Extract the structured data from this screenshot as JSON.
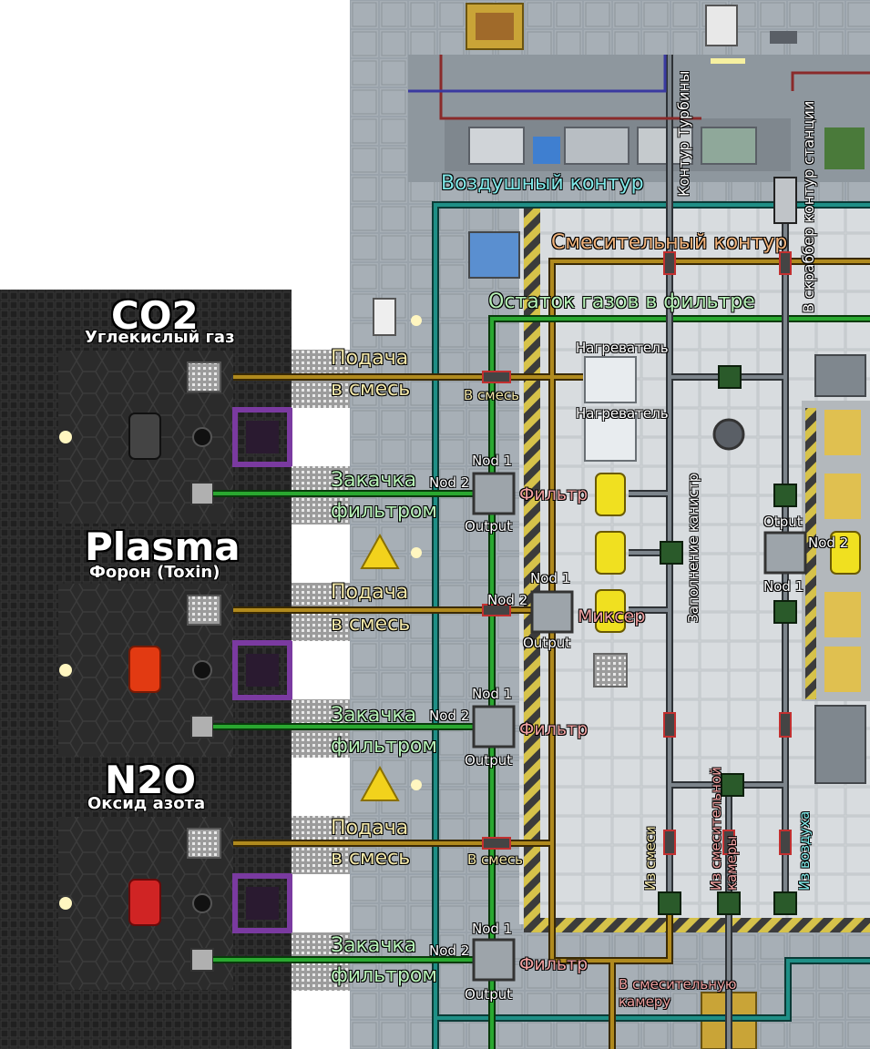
{
  "rooms": [
    {
      "title": "CO2",
      "subtitle": "Углекислый газ"
    },
    {
      "title": "Plasma",
      "subtitle": "Форон (Toxin)"
    },
    {
      "title": "N2O",
      "subtitle": "Оксид азота"
    }
  ],
  "captions": {
    "supply_line1": "Подача",
    "supply_line2": "в смесь",
    "pump_line1": "Закачка",
    "pump_line2": "фильтром"
  },
  "loops": {
    "air": "Воздушный контур",
    "mixing": "Смесительный контур",
    "filter_rest": "Остаток газов в фильтре",
    "turbine": "Контур Турбины",
    "scrubber": "В скраббер контур станции"
  },
  "devices": {
    "heater": "Нагреватель",
    "filter": "Фильтр",
    "mixer": "Миксер",
    "to_mix": "В смесь",
    "node1": "Nod 1",
    "node2": "Nod 2",
    "output": "Output",
    "otput": "Otput",
    "canister_fill": "Заполнение канистр",
    "from_mix": "Из смеси",
    "from_mix_chamber": "Из смесительной камеры",
    "from_air": "Из воздуха",
    "to_mix_chamber": "В смесительную камеру"
  },
  "colors": {
    "pipe_yellow": "#8a6a16",
    "pipe_green": "#1e8a24",
    "pipe_cyan": "#1f8f86",
    "pipe_grey": "#5a5f66",
    "floor_dark": "#242424",
    "floor_station": "#9aa3ab",
    "hazard": "#d6c24a",
    "purple": "#7a3aa0",
    "can_co2": "#444444",
    "can_plasma": "#e23a12",
    "can_n2o": "#d02424",
    "can_yellow": "#f0e020"
  }
}
